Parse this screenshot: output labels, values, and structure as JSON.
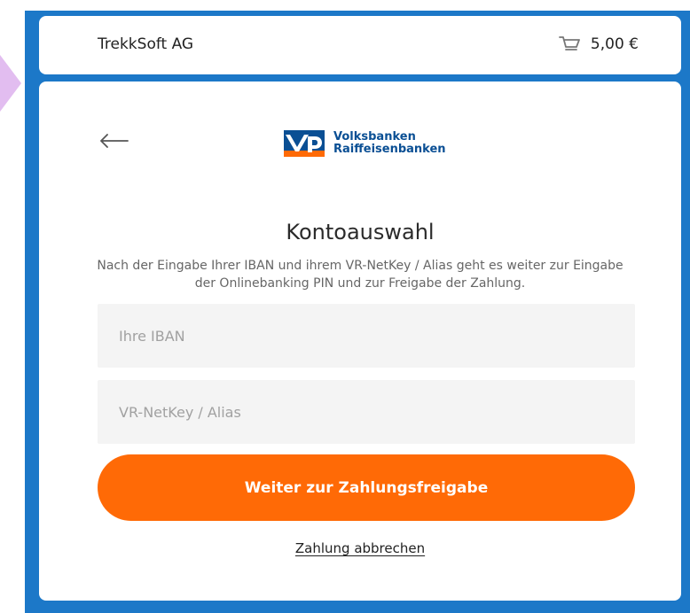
{
  "header": {
    "merchant_name": "TrekkSoft AG",
    "cart_total": "5,00 €"
  },
  "bank": {
    "name_line1": "Volksbanken",
    "name_line2": "Raiffeisenbanken",
    "logo_icon": "vr-bank-logo-icon"
  },
  "page": {
    "title": "Kontoauswahl",
    "description": "Nach der Eingabe Ihrer IBAN und ihrem VR-NetKey / Alias geht es weiter zur Eingabe der Onlinebanking PIN und zur Freigabe der Zahlung."
  },
  "fields": {
    "iban_placeholder": "Ihre IBAN",
    "netkey_placeholder": "VR-NetKey / Alias"
  },
  "actions": {
    "continue_label": "Weiter zur Zahlungsfreigabe",
    "cancel_label": "Zahlung abbrechen"
  },
  "colors": {
    "page_background": "#1c78c8",
    "primary_button": "#ff6a06",
    "bank_blue": "#0a4f94",
    "bank_orange": "#ff6a06"
  },
  "icons": {
    "back": "arrow-left-icon",
    "cart": "shopping-cart-icon"
  }
}
